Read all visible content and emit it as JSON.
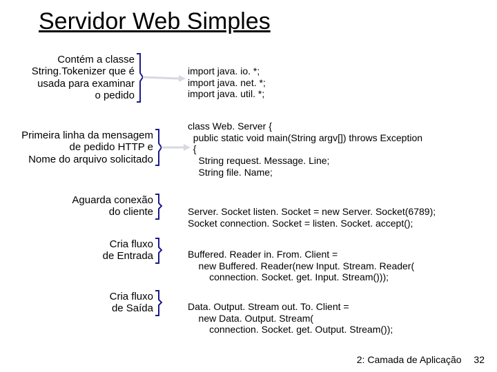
{
  "title": "Servidor Web Simples",
  "annotations": {
    "a1_l1": "Contém a classe",
    "a1_l2": "String.Tokenizer que é",
    "a1_l3": "usada para examinar",
    "a1_l4": "o pedido",
    "a2_l1": "Primeira linha da mensagem",
    "a2_l2": "de pedido HTTP e",
    "a2_l3": "Nome do arquivo solicitado",
    "a3_l1": "Aguarda conexão",
    "a3_l2": "do cliente",
    "a4_l1": "Cria fluxo",
    "a4_l2": "de Entrada",
    "a5_l1": "Cria fluxo",
    "a5_l2": "de Saída"
  },
  "code": {
    "c1_l1": "import java. io. *;",
    "c1_l2": "import java. net. *;",
    "c1_l3": "import java. util. *;",
    "c2_l1": "class Web. Server {",
    "c2_l2": "  public static void main(String argv[]) throws Exception",
    "c2_l3": "  {",
    "c2_l4": "    String request. Message. Line;",
    "c2_l5": "    String file. Name;",
    "c3_l1": "Server. Socket listen. Socket = new Server. Socket(6789);",
    "c3_l2": "Socket connection. Socket = listen. Socket. accept();",
    "c4_l1": "Buffered. Reader in. From. Client =",
    "c4_l2": "    new Buffered. Reader(new Input. Stream. Reader(",
    "c4_l3": "        connection. Socket. get. Input. Stream()));",
    "c5_l1": "Data. Output. Stream out. To. Client =",
    "c5_l2": "    new Data. Output. Stream(",
    "c5_l3": "        connection. Socket. get. Output. Stream());"
  },
  "footer": {
    "label": "2: Camada de Aplicação",
    "page": "32"
  },
  "colors": {
    "brace": "#1a1a88",
    "arrow": "#d8d8e0"
  }
}
